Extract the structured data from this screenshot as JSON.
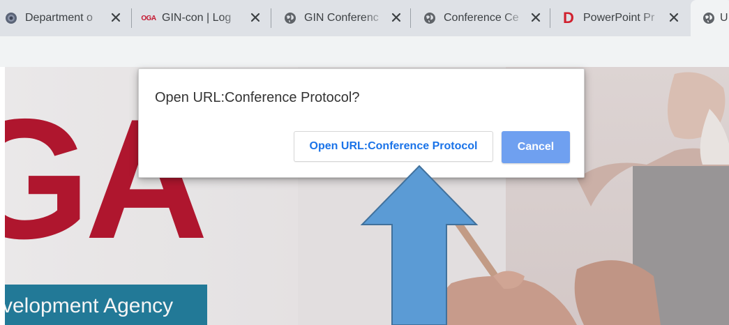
{
  "tabs": [
    {
      "title": "Department o",
      "favicon": "department-seal-icon"
    },
    {
      "title": "GIN-con | Log",
      "favicon": "oga-logo-icon",
      "favicon_text": "OGA"
    },
    {
      "title": "GIN Conferenc",
      "favicon": "globe-icon"
    },
    {
      "title": "Conference Ce",
      "favicon": "globe-icon"
    },
    {
      "title": "PowerPoint Pr",
      "favicon": "d-logo-icon",
      "favicon_text": "D"
    },
    {
      "title": "U",
      "favicon": "globe-icon",
      "active": true
    }
  ],
  "page": {
    "brand_letters": "GA",
    "brand_tagline": "velopment Agency",
    "colors": {
      "brand_red": "#b5132c",
      "brand_teal": "#1f7c9c",
      "arrow_fill": "#5b9bd5",
      "arrow_stroke": "#41719c"
    }
  },
  "dialog": {
    "message": "Open URL:Conference Protocol?",
    "open_button": "Open URL:Conference Protocol",
    "cancel_button": "Cancel",
    "colors": {
      "open_text": "#1a73e8",
      "cancel_bg": "#6fa0f0"
    }
  },
  "annotation": {
    "arrow": "up-arrow"
  }
}
